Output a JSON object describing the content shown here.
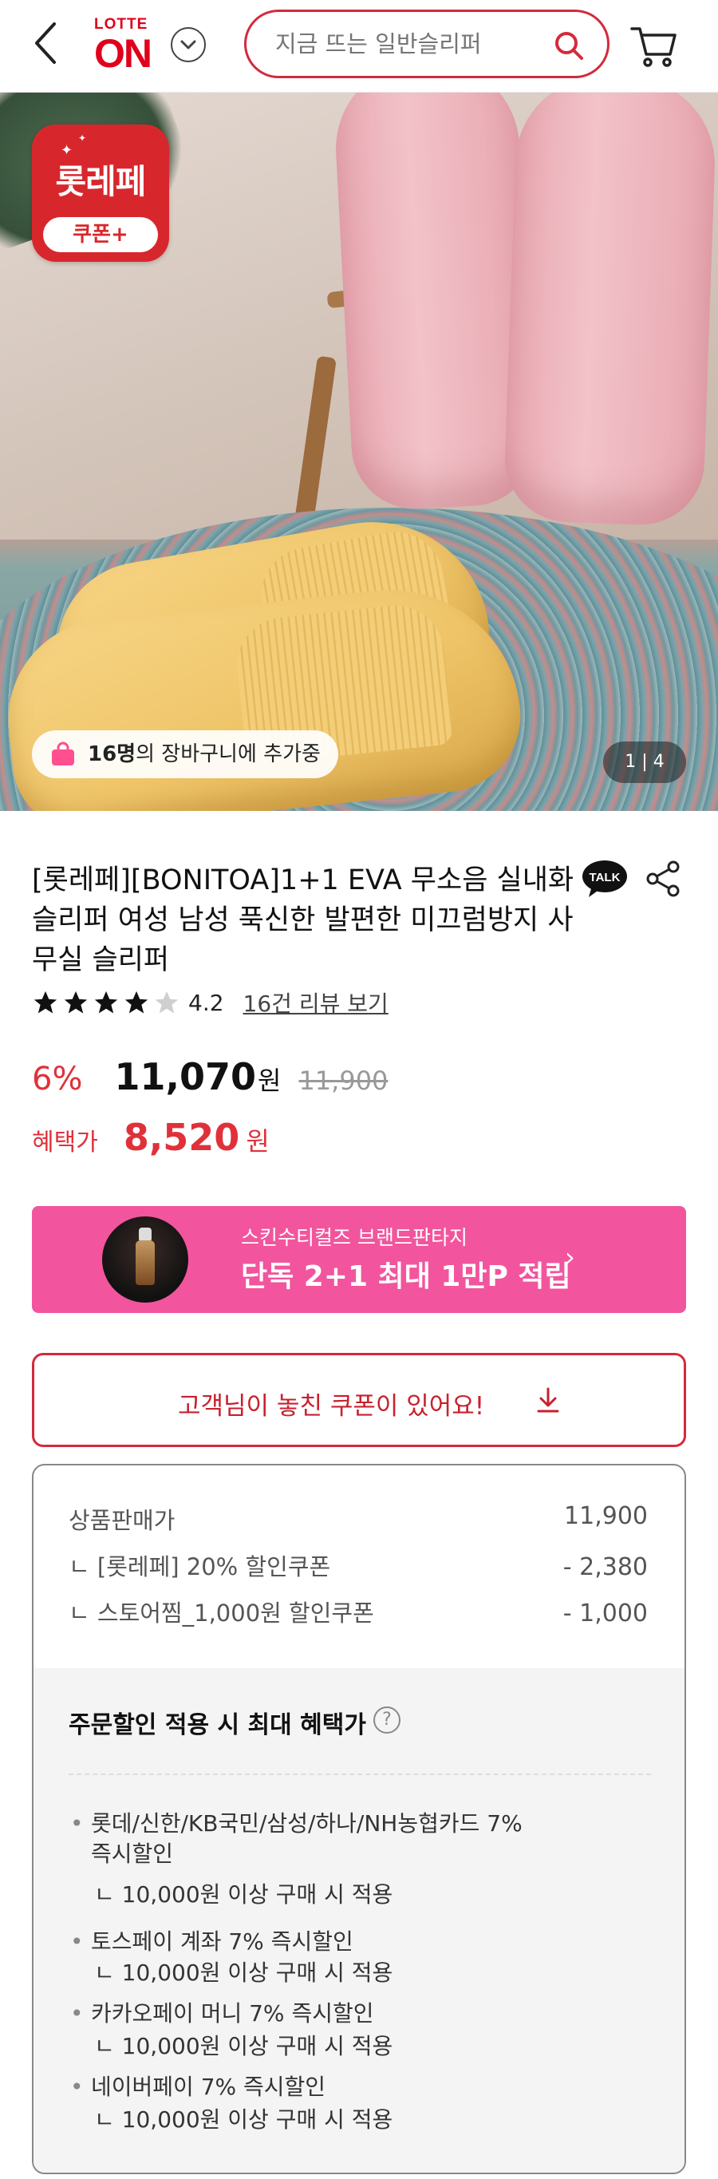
{
  "header": {
    "logo_top": "LOTTE",
    "logo_main": "ON",
    "search_placeholder": "지금 뜨는 일반슬리퍼"
  },
  "hero": {
    "badge_title": "롯레페",
    "badge_sub": "쿠폰+",
    "cart_count": "16명",
    "cart_text": "의 장바구니에 추가중",
    "image_counter": "1 | 4"
  },
  "product": {
    "title": "[롯레페][BONITOA]1+1 EVA 무소음 실내화 슬리퍼 여성 남성 푹신한 발편한 미끄럼방지 사무실 슬리퍼",
    "rating": "4.2",
    "rating_value": 4.2,
    "review_link": "16건 리뷰 보기",
    "discount": "6%",
    "price": "11,070",
    "won": "원",
    "original_price": "11,900",
    "benefit_label": "혜택가",
    "benefit_price": "8,520",
    "benefit_won": "원"
  },
  "promo": {
    "sub": "스킨수티컬즈 브랜드판타지",
    "main": "단독 2+1 최대 1만P 적립",
    "arrow": "›",
    "color": "#f2559d"
  },
  "coupon_button": {
    "label": "고객님이 놓친 쿠폰이 있어요!"
  },
  "breakdown": {
    "sale_label": "상품판매가",
    "sale_value": "11,900",
    "coupon1_label": "ㄴ [롯레페] 20% 할인쿠폰",
    "coupon1_value": "- 2,380",
    "coupon2_label": "ㄴ 스토어찜_1,000원 할인쿠폰",
    "coupon2_value": "- 1,000",
    "max_title": "주문할인 적용 시 최대 혜택가",
    "items": [
      {
        "text": "롯데/신한/KB국민/삼성/하나/NH농협카드 7% 즉시할인",
        "cond": "ㄴ 10,000원 이상 구매 시 적용"
      },
      {
        "text": "토스페이 계좌 7% 즉시할인",
        "cond": "ㄴ 10,000원 이상 구매 시 적용"
      },
      {
        "text": "카카오페이 머니 7% 즉시할인",
        "cond": "ㄴ 10,000원 이상 구매 시 적용"
      },
      {
        "text": "네이버페이 7% 즉시할인",
        "cond": "ㄴ 10,000원 이상 구매 시 적용"
      }
    ]
  },
  "colors": {
    "brand_red": "#e0001b",
    "accent_red": "#d42a3c",
    "discount_red": "#e0313b",
    "promo_pink": "#f2559d"
  }
}
